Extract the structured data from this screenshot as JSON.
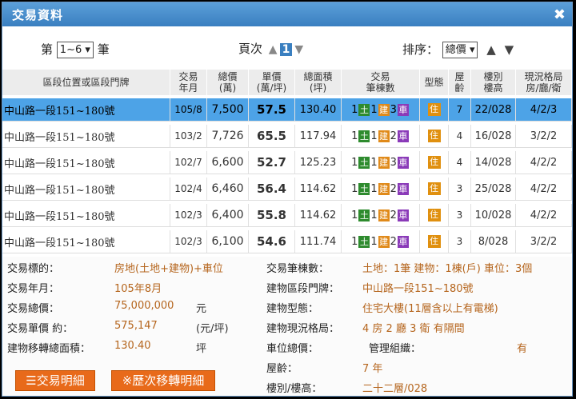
{
  "window": {
    "title": "交易資料",
    "close": "✖"
  },
  "pager": {
    "prefix": "第",
    "selected": "1~6",
    "suffix": "筆"
  },
  "pageinfo": {
    "label": "頁次",
    "current": "1"
  },
  "sort": {
    "label": "排序：",
    "selected": "總價"
  },
  "table": {
    "headers": [
      "區段位置或區段門牌",
      "交易\n年月",
      "總價\n(萬)",
      "單價\n(萬/坪)",
      "總面積\n(坪)",
      "交易\n筆棟數",
      "型態",
      "屋\n齡",
      "樓別\n樓高",
      "現況格局\n房/廳/衛"
    ],
    "rows": [
      {
        "addr": "中山路一段151~180號",
        "date": "105/8",
        "total": "7,500",
        "unit": "57.5",
        "area": "130.40",
        "land": "1",
        "bld": "1",
        "car": "3",
        "type": "住",
        "age": "7",
        "floor": "22/028",
        "layout": "4/2/3"
      },
      {
        "addr": "中山路一段151~180號",
        "date": "103/2",
        "total": "7,726",
        "unit": "65.5",
        "area": "117.94",
        "land": "1",
        "bld": "1",
        "car": "2",
        "type": "住",
        "age": "4",
        "floor": "16/028",
        "layout": "3/2/2"
      },
      {
        "addr": "中山路一段151~180號",
        "date": "102/7",
        "total": "6,600",
        "unit": "52.7",
        "area": "125.23",
        "land": "1",
        "bld": "1",
        "car": "3",
        "type": "住",
        "age": "4",
        "floor": "14/028",
        "layout": "4/2/2"
      },
      {
        "addr": "中山路一段151~180號",
        "date": "102/4",
        "total": "6,460",
        "unit": "56.4",
        "area": "114.62",
        "land": "1",
        "bld": "1",
        "car": "2",
        "type": "住",
        "age": "3",
        "floor": "25/028",
        "layout": "4/2/2"
      },
      {
        "addr": "中山路一段151~180號",
        "date": "102/3",
        "total": "6,400",
        "unit": "55.8",
        "area": "114.62",
        "land": "1",
        "bld": "1",
        "car": "2",
        "type": "住",
        "age": "3",
        "floor": "10/028",
        "layout": "4/2/2"
      },
      {
        "addr": "中山路一段151~180號",
        "date": "102/3",
        "total": "6,100",
        "unit": "54.6",
        "area": "111.74",
        "land": "1",
        "bld": "1",
        "car": "2",
        "type": "住",
        "age": "3",
        "floor": "8/028",
        "layout": "3/2/2"
      }
    ],
    "icons": {
      "land": "土",
      "bld": "建",
      "car": "車"
    }
  },
  "detail": {
    "left": [
      {
        "label": "交易標的：",
        "value": "房地(土地+建物)+車位",
        "unit": ""
      },
      {
        "label": "交易年月：",
        "value": "105年8月",
        "unit": ""
      },
      {
        "label": "交易總價：",
        "value": "75,000,000",
        "unit": "元"
      },
      {
        "label": "交易單價 約：",
        "value": "575,147",
        "unit": "(元/坪)"
      },
      {
        "label": "建物移轉總面積：",
        "value": "130.40",
        "unit": "坪"
      }
    ],
    "right": [
      {
        "label": "交易筆棟數：",
        "value": "土地：1筆 建物：1棟(戶) 車位：3個"
      },
      {
        "label": "建物區段門牌：",
        "value": "中山路一段151~180號"
      },
      {
        "label": "建物型態：",
        "value": "住宅大樓(11層含以上有電梯)"
      },
      {
        "label": "建物現況格局：",
        "value": "4 房 2 廳 3 衛 有隔間"
      },
      {
        "label": "車位總價：",
        "value": ""
      },
      {
        "label": "屋齡：",
        "value": "7 年"
      },
      {
        "label": "樓別/樓高：",
        "value": "二十二層/028"
      }
    ],
    "mgmt_label": "管理組織：",
    "mgmt_value": "有",
    "buttons": {
      "detail": "☰交易明細",
      "history": "※歷次移轉明細"
    }
  },
  "colors": {
    "titlebar": "#3a7fc0",
    "highlight": "#4da3e7",
    "accent": "#e86a1a",
    "value": "#b5651d"
  }
}
